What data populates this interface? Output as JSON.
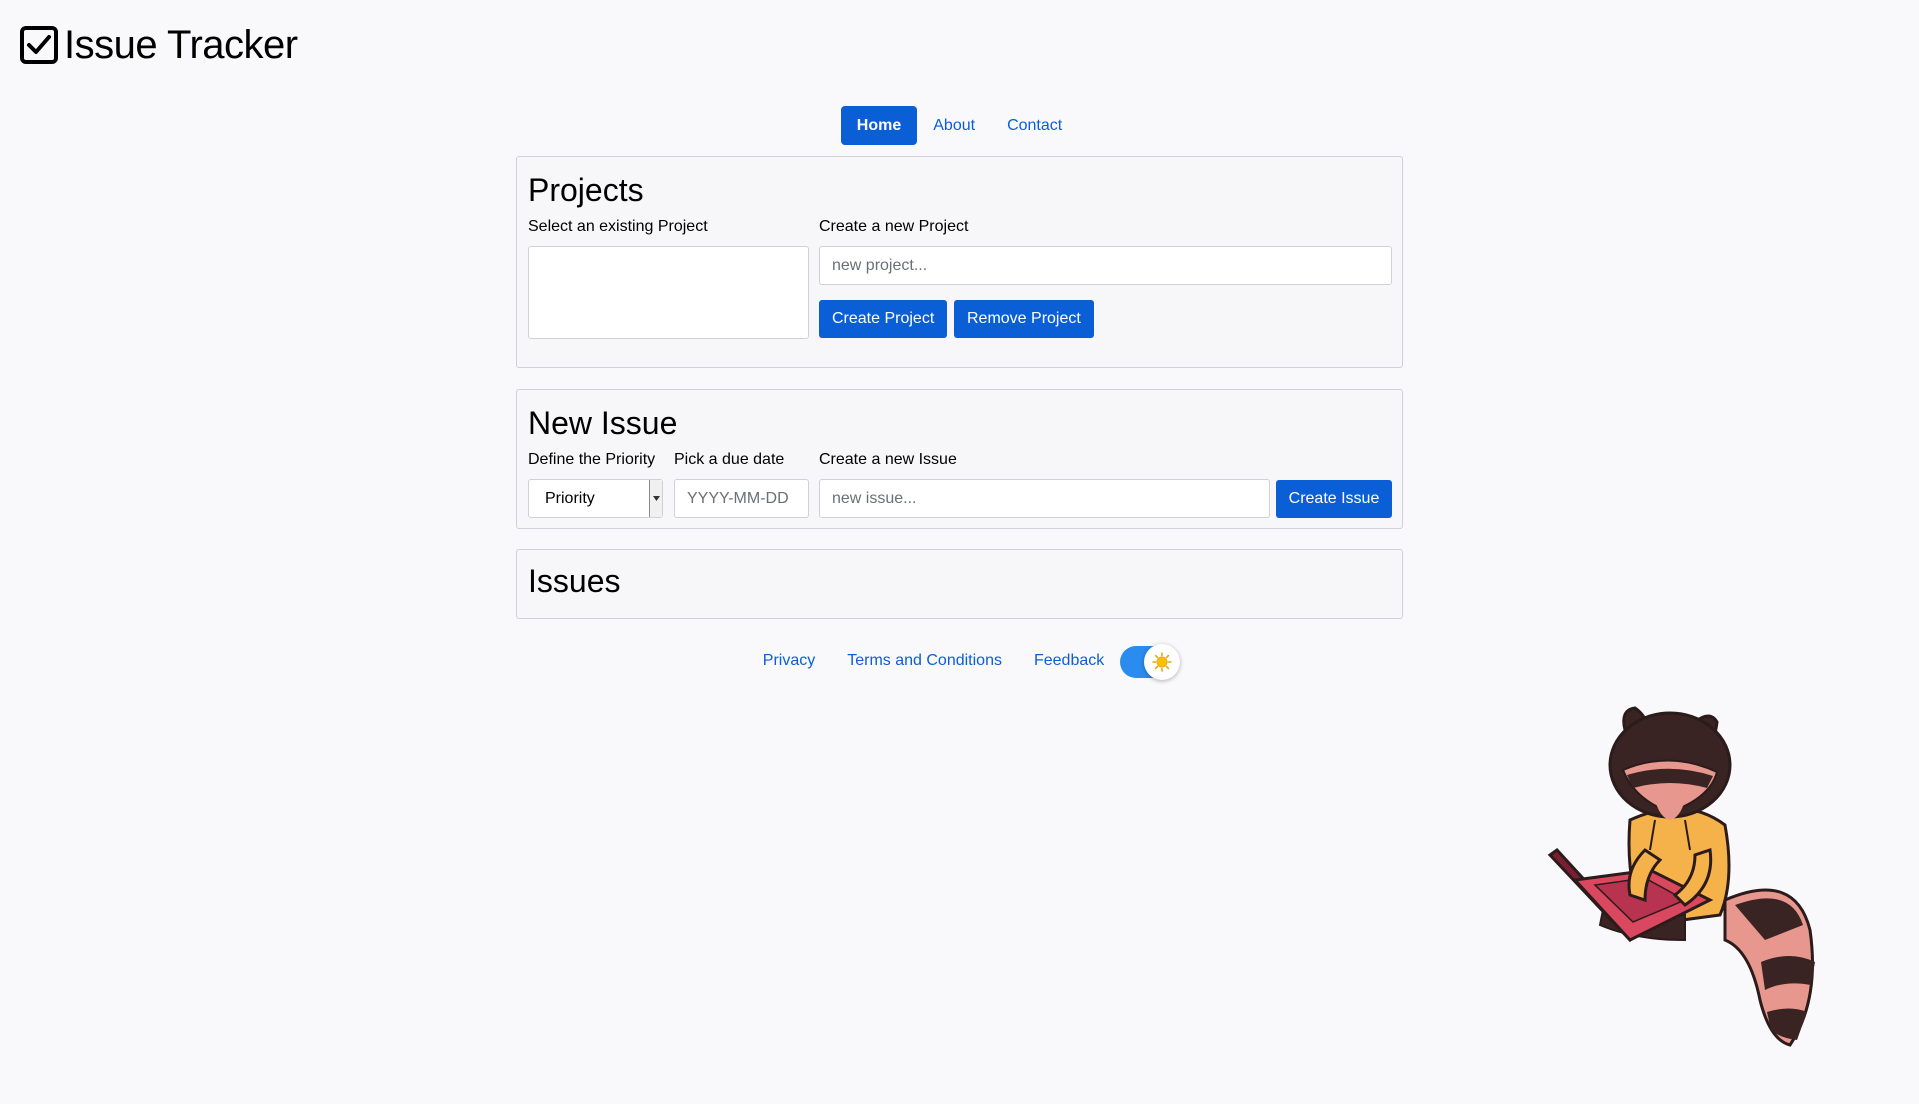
{
  "brand": {
    "title": "Issue Tracker"
  },
  "nav": {
    "items": [
      {
        "label": "Home",
        "active": true
      },
      {
        "label": "About",
        "active": false
      },
      {
        "label": "Contact",
        "active": false
      }
    ]
  },
  "projects": {
    "heading": "Projects",
    "select_label": "Select an existing Project",
    "create_label": "Create a new Project",
    "new_project_placeholder": "new project...",
    "create_button": "Create Project",
    "remove_button": "Remove Project"
  },
  "new_issue": {
    "heading": "New Issue",
    "priority_label": "Define the Priority",
    "priority_value": "Priority",
    "due_date_label": "Pick a due date",
    "due_date_placeholder": "YYYY-MM-DD",
    "create_label": "Create a new Issue",
    "new_issue_placeholder": "new issue...",
    "create_button": "Create Issue"
  },
  "issues": {
    "heading": "Issues"
  },
  "footer": {
    "links": [
      "Privacy",
      "Terms and Conditions",
      "Feedback"
    ],
    "theme_toggle": "light"
  },
  "colors": {
    "primary": "#0a5fd7",
    "link": "#0b5ed7",
    "toggle": "#2a8cef",
    "background": "#f9f9fb"
  }
}
